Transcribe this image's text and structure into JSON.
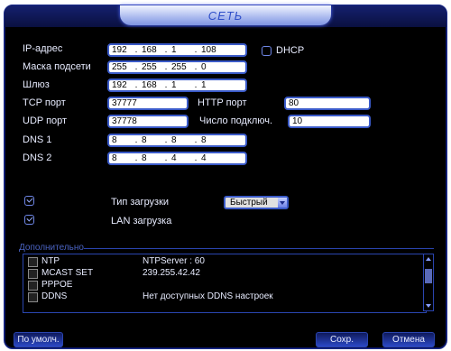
{
  "window": {
    "title": "СЕТЬ"
  },
  "form": {
    "ip_label": "IP-адрес",
    "ip": [
      "192",
      "168",
      "1",
      "108"
    ],
    "dhcp_label": "DHCP",
    "mask_label": "Маска подсети",
    "mask": [
      "255",
      "255",
      "255",
      "0"
    ],
    "gateway_label": "Шлюз",
    "gateway": [
      "192",
      "168",
      "1",
      "1"
    ],
    "tcp_label": "TCP порт",
    "tcp_value": "37777",
    "http_label": "HTTP порт",
    "http_value": "80",
    "udp_label": "UDP порт",
    "udp_value": "37778",
    "conn_label": "Число подключ.",
    "conn_value": "10",
    "dns1_label": "DNS 1",
    "dns1": [
      "8",
      "8",
      "8",
      "8"
    ],
    "dns2_label": "DNS 2",
    "dns2": [
      "8",
      "8",
      "4",
      "4"
    ],
    "load_type_label": "Тип загрузки",
    "load_type_value": "Быстрый",
    "lan_load_label": "LAN загрузка"
  },
  "advanced": {
    "section_label": "Дополнительно",
    "items": [
      {
        "name": "NTP",
        "value": "NTPServer : 60"
      },
      {
        "name": "MCAST SET",
        "value": "239.255.42.42"
      },
      {
        "name": "PPPOE",
        "value": ""
      },
      {
        "name": "DDNS",
        "value": "Нет доступных DDNS настроек"
      }
    ]
  },
  "buttons": {
    "default_label": "По умолч.",
    "save_label": "Сохр.",
    "cancel_label": "Отмена"
  }
}
